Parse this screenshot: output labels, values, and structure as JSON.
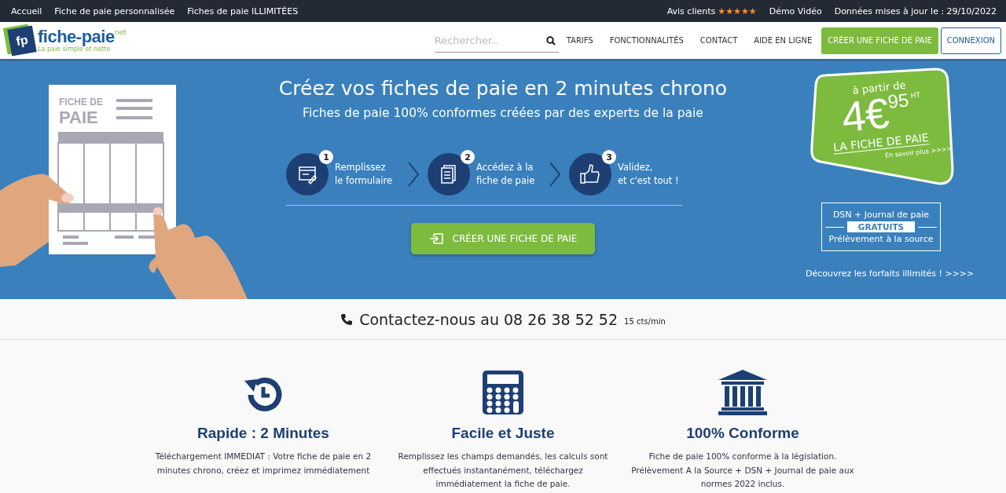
{
  "top_bar": {
    "left_links": [
      "Accueil",
      "Fiche de paie personnalisée",
      "Fiches de paie ILLIMITÉES"
    ],
    "reviews": {
      "label": "Avis clients",
      "stars": 5
    },
    "right_links": [
      "Démo Vidéo",
      "Données mises à jour le : 29/10/2022"
    ]
  },
  "header": {
    "logo": {
      "mark": "fp",
      "name": "fiche-paie",
      "suffix": "net",
      "tagline": "La paie simple et nette"
    },
    "search": {
      "placeholder": "Rechercher.."
    },
    "nav": [
      "TARIFS",
      "FONCTIONNALITÉS",
      "CONTACT",
      "AIDE EN LIGNE"
    ],
    "create_button": "CRÉER UNE FICHE DE PAIE",
    "login_button": "CONNEXION"
  },
  "hero": {
    "illustration": {
      "title_top": "FICHE DE",
      "title_bottom": "PAIE"
    },
    "title": "Créez vos fiches de paie en 2 minutes chrono",
    "subtitle": "Fiches de paie 100% conformes créées par des experts de la paie",
    "steps": [
      {
        "number": "1",
        "kind": "form",
        "line1": "Remplissez",
        "line2": "le formulaire"
      },
      {
        "number": "2",
        "kind": "document",
        "line1": "Accédez à la",
        "line2": "fiche de paie"
      },
      {
        "number": "3",
        "kind": "thumb",
        "line1": "Validez,",
        "line2": "et c'est tout !"
      }
    ],
    "cta": "CRÉER UNE FICHE DE PAIE",
    "price": {
      "from": "à partir de",
      "amount": "4€",
      "cents": "95",
      "tax": "HT",
      "label": "LA FICHE DE PAIE",
      "more": "En savoir plus >>>>"
    },
    "free_box": {
      "line1": "DSN + Journal de paie",
      "badge": "GRATUITS",
      "line2": "Prélèvement à la source"
    },
    "unlimited_link": "Découvrez les forfaits illimités ! >>>>"
  },
  "contact": {
    "text": "Contactez-nous au 08 26 38 52 52",
    "rate": "15 cts/min"
  },
  "features": [
    {
      "kind": "clock",
      "title": "Rapide : 2 Minutes",
      "text": "Téléchargement IMMEDIAT : Votre fiche de paie en 2 minutes chrono, créez et imprimez immédiatement"
    },
    {
      "kind": "calculator",
      "title": "Facile et Juste",
      "text": "Remplissez les champs demandés, les calculs sont effectués instantanément, téléchargez immédiatement la fiche de paie."
    },
    {
      "kind": "bank",
      "title": "100% Conforme",
      "text": "Fiche de paie 100% conforme à la législation. Prélèvement A la Source + DSN + Journal de paie aux normes 2022 inclus."
    }
  ]
}
